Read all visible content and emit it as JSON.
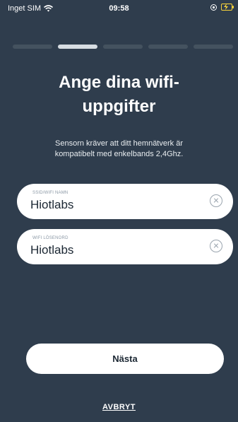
{
  "status_bar": {
    "carrier": "Inget SIM",
    "time": "09:58"
  },
  "progress": {
    "total_steps": 5,
    "current_step": 2
  },
  "header": {
    "title": "Ange dina wifi-uppgifter",
    "subtitle": "Sensorn kräver att ditt hemnätverk är kompatibelt med enkelbands 2,4Ghz."
  },
  "form": {
    "ssid": {
      "label": "SSID/WIFI NAMN",
      "value": "Hiotlabs"
    },
    "password": {
      "label": "WIFI LÖSENORD",
      "value": "Hiotlabs"
    }
  },
  "actions": {
    "next_label": "Nästa",
    "cancel_label": "AVBRYT"
  },
  "colors": {
    "background": "#2f3d4d",
    "battery": "#f7d33b"
  }
}
